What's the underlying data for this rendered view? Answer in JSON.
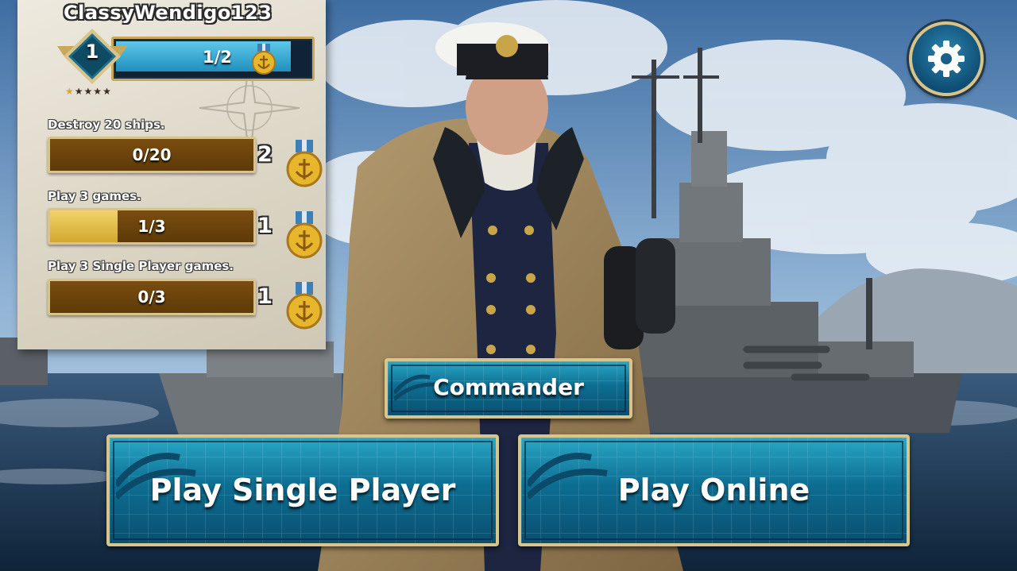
{
  "player": {
    "username": "ClassyWendigo123",
    "level": "1",
    "xp_text": "1/2",
    "xp_progress": 0.9,
    "stars": {
      "earned": 1,
      "total": 5
    }
  },
  "quests": [
    {
      "title": "Destroy 20 ships.",
      "progress_text": "0/20",
      "progress": 0.0,
      "reward": "2"
    },
    {
      "title": "Play 3 games.",
      "progress_text": "1/3",
      "progress": 0.333,
      "reward": "1"
    },
    {
      "title": "Play 3 Single Player games.",
      "progress_text": "0/3",
      "progress": 0.0,
      "reward": "1"
    }
  ],
  "buttons": {
    "commander": "Commander",
    "single_player": "Play Single Player",
    "online": "Play Online"
  },
  "icons": {
    "settings": "gear-icon",
    "medal": "anchor-medal-icon",
    "level": "level-diamond-icon"
  },
  "colors": {
    "button_teal": "#1a8fb5",
    "button_border": "#d9c58c",
    "quest_fill": "#e6bf4a",
    "quest_track": "#6b4410",
    "xp_fill": "#3fb0da",
    "medal_gold": "#e8b62c"
  }
}
